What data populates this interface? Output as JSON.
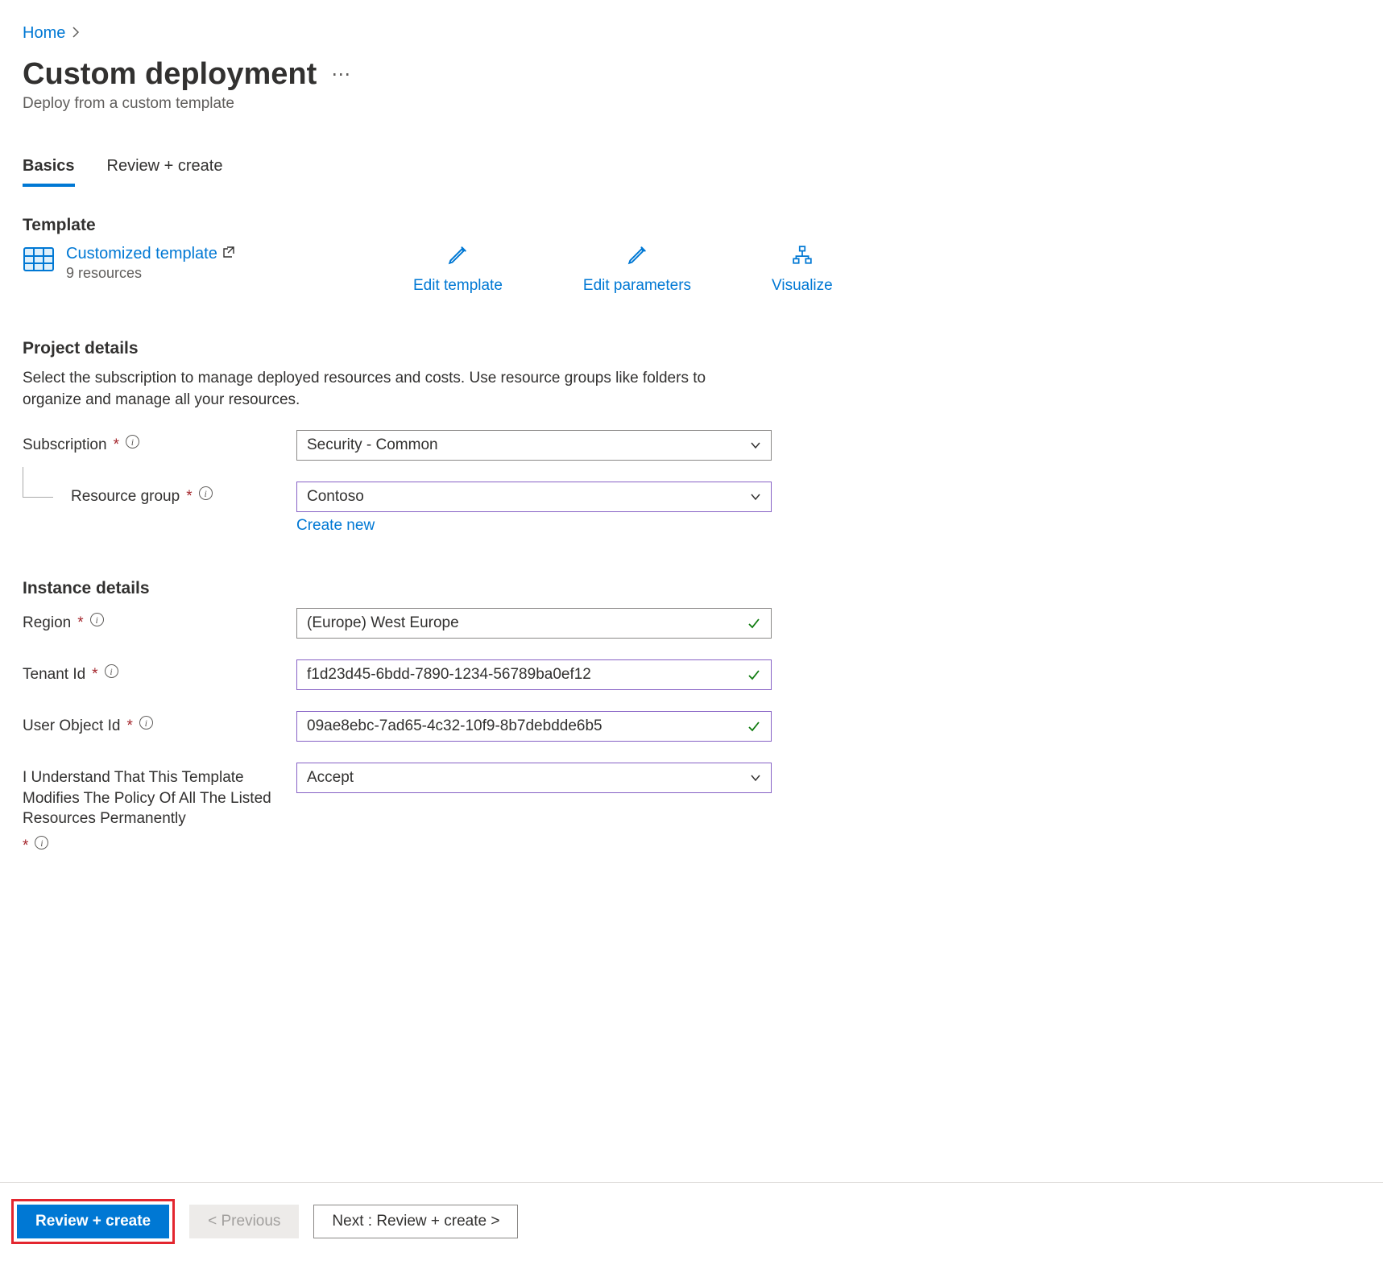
{
  "breadcrumb": {
    "home": "Home"
  },
  "page": {
    "title": "Custom deployment",
    "subtitle": "Deploy from a custom template"
  },
  "tabs": {
    "basics": "Basics",
    "review": "Review + create"
  },
  "template": {
    "heading": "Template",
    "link": "Customized template",
    "resources": "9 resources",
    "edit_template": "Edit template",
    "edit_parameters": "Edit parameters",
    "visualize": "Visualize"
  },
  "project": {
    "heading": "Project details",
    "desc": "Select the subscription to manage deployed resources and costs. Use resource groups like folders to organize and manage all your resources.",
    "subscription_label": "Subscription",
    "subscription_value": "Security - Common",
    "rg_label": "Resource group",
    "rg_value": "Contoso",
    "create_new": "Create new"
  },
  "instance": {
    "heading": "Instance details",
    "region_label": "Region",
    "region_value": "(Europe) West Europe",
    "tenant_label": "Tenant Id",
    "tenant_value": "f1d23d45-6bdd-7890-1234-56789ba0ef12",
    "userobj_label": "User Object Id",
    "userobj_value": "09ae8ebc-7ad65-4c32-10f9-8b7debdde6b5",
    "accept_label": "I Understand That This Template Modifies The Policy Of All The Listed Resources Permanently",
    "accept_value": "Accept"
  },
  "footer": {
    "review_create": "Review + create",
    "previous": "< Previous",
    "next": "Next : Review + create >"
  }
}
